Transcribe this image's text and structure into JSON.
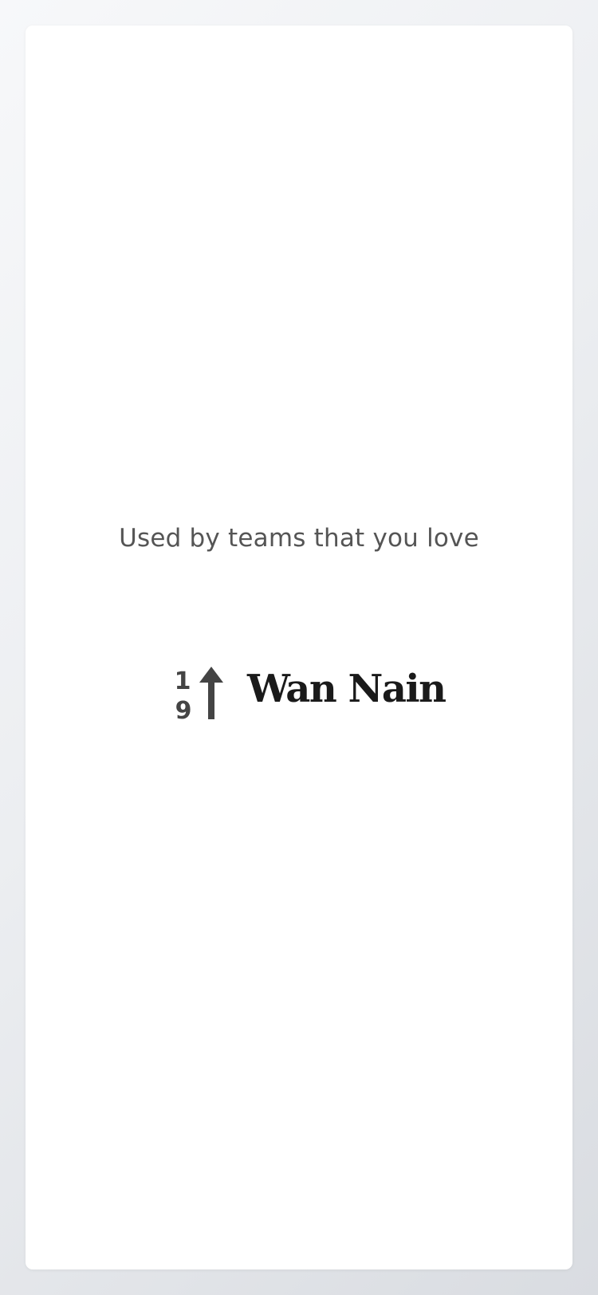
{
  "main": {
    "tagline": "Used by teams that you love",
    "logo": {
      "icon": "nineteen-up-arrow-icon",
      "icon_text_top": "1",
      "icon_text_bottom": "9",
      "name": "Wan Nain"
    }
  },
  "colors": {
    "background": "#eceef1",
    "card": "#ffffff",
    "tagline_text": "#555555",
    "logo_mark": "#444444",
    "logo_text": "#1a1a1a"
  }
}
